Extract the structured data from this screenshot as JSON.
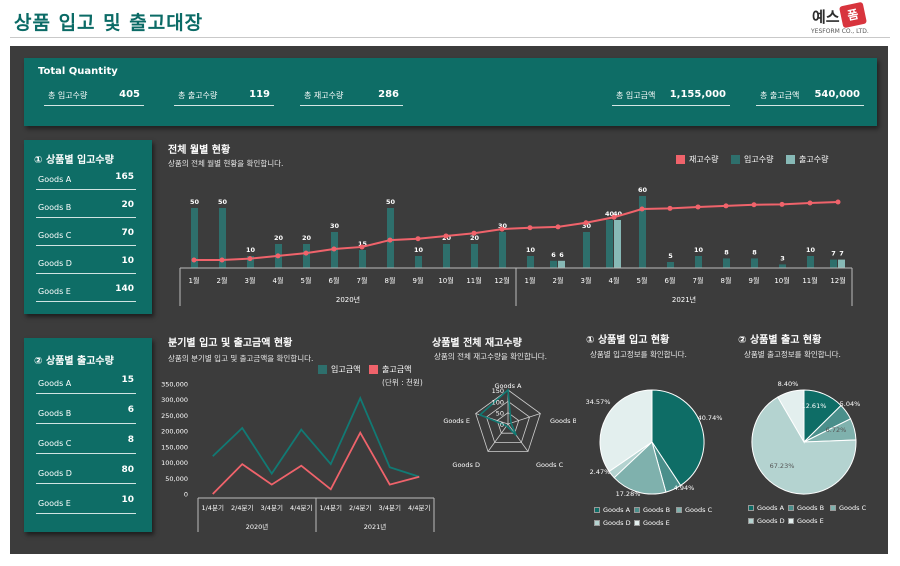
{
  "header": {
    "title": "상품 입고 및 출고대장",
    "logo_text": "예스",
    "logo_badge": "폼",
    "logo_sub": "YESFORM CO., LTD."
  },
  "totals": {
    "title": "Total Quantity",
    "items": [
      {
        "label": "총 입고수량",
        "value": "405"
      },
      {
        "label": "총 출고수량",
        "value": "119"
      },
      {
        "label": "총 재고수량",
        "value": "286"
      },
      {
        "label": "총 입고금액",
        "value": "1,155,000"
      },
      {
        "label": "총 출고금액",
        "value": "540,000"
      }
    ]
  },
  "in_panel": {
    "title": "① 상품별 입고수량",
    "rows": [
      {
        "label": "Goods A",
        "value": "165"
      },
      {
        "label": "Goods B",
        "value": "20"
      },
      {
        "label": "Goods C",
        "value": "70"
      },
      {
        "label": "Goods D",
        "value": "10"
      },
      {
        "label": "Goods E",
        "value": "140"
      }
    ]
  },
  "out_panel": {
    "title": "② 상품별 출고수량",
    "rows": [
      {
        "label": "Goods A",
        "value": "15"
      },
      {
        "label": "Goods B",
        "value": "6"
      },
      {
        "label": "Goods C",
        "value": "8"
      },
      {
        "label": "Goods D",
        "value": "80"
      },
      {
        "label": "Goods E",
        "value": "10"
      }
    ]
  },
  "monthly": {
    "title": "전체 월별 현황",
    "subtitle": "상품의 전체 월별 현황을 확인합니다.",
    "legend": [
      "재고수량",
      "입고수량",
      "출고수량"
    ],
    "colors": {
      "stock": "#f0636b",
      "in": "#2e6f6c",
      "out": "#87b9b6"
    }
  },
  "quarterly": {
    "title": "분기별 입고 및 출고금액 현황",
    "subtitle": "상품의 분기별 입고 및 출고금액을 확인합니다.",
    "legend": [
      "입고금액",
      "출고금액"
    ],
    "unit": "(단위 : 천원)"
  },
  "radar": {
    "title": "상품별 전체 재고수량",
    "subtitle": "상품의 전체 재고수량을 확인합니다."
  },
  "pie_in": {
    "title": "① 상품별 입고 현황",
    "subtitle": "상품별 입고정보를 확인합니다."
  },
  "pie_out": {
    "title": "② 상품별 출고 현황",
    "subtitle": "상품별 출고정보를 확인합니다."
  },
  "chart_data": [
    {
      "type": "bar",
      "title": "전체 월별 현황",
      "categories": [
        "1월",
        "2월",
        "3월",
        "4월",
        "5월",
        "6월",
        "7월",
        "8월",
        "9월",
        "10월",
        "11월",
        "12월",
        "1월",
        "2월",
        "3월",
        "4월",
        "5월",
        "6월",
        "7월",
        "8월",
        "9월",
        "10월",
        "11월",
        "12월"
      ],
      "groups": [
        {
          "label": "2020년",
          "from": 0,
          "to": 11
        },
        {
          "label": "2021년",
          "from": 12,
          "to": 23
        }
      ],
      "series": [
        {
          "name": "입고수량",
          "values": [
            50,
            50,
            10,
            20,
            20,
            30,
            15,
            50,
            10,
            20,
            20,
            30,
            10,
            6,
            30,
            40,
            60,
            5,
            10,
            8,
            8,
            3,
            10,
            7
          ]
        },
        {
          "name": "출고수량",
          "values": [
            0,
            0,
            0,
            0,
            0,
            0,
            0,
            0,
            0,
            0,
            0,
            0,
            0,
            6,
            0,
            40,
            0,
            0,
            0,
            0,
            0,
            0,
            0,
            7
          ]
        },
        {
          "name": "재고수량",
          "values": [
            50,
            50,
            60,
            80,
            100,
            130,
            145,
            195,
            205,
            225,
            245,
            275,
            285,
            291,
            321,
            361,
            421,
            426,
            436,
            444,
            452,
            455,
            465,
            472
          ]
        }
      ],
      "ylim": [
        0,
        60
      ]
    },
    {
      "type": "line",
      "title": "분기별 입고 및 출고금액 현황",
      "categories": [
        "1/4분기",
        "2/4분기",
        "3/4분기",
        "4/4분기",
        "1/4분기",
        "2/4분기",
        "3/4분기",
        "4/4분기"
      ],
      "groups": [
        {
          "label": "2020년",
          "from": 0,
          "to": 3
        },
        {
          "label": "2021년",
          "from": 4,
          "to": 7
        }
      ],
      "series": [
        {
          "name": "입고금액",
          "values": [
            120000,
            210000,
            65000,
            205000,
            95000,
            305000,
            85000,
            55000
          ]
        },
        {
          "name": "출고금액",
          "values": [
            0,
            95000,
            30000,
            90000,
            15000,
            195000,
            30000,
            55000
          ]
        }
      ],
      "ylim": [
        0,
        350000
      ],
      "yticks": [
        "350,000",
        "300,000",
        "250,000",
        "200,000",
        "150,000",
        "100,000",
        "50,000",
        "0"
      ]
    },
    {
      "type": "radar",
      "title": "상품별 전체 재고수량",
      "categories": [
        "Goods A",
        "Goods B",
        "Goods C",
        "Goods D",
        "Goods E"
      ],
      "values": [
        150,
        14,
        62,
        10,
        130
      ],
      "ticks": [
        "150",
        "100",
        "50",
        "0"
      ],
      "rmax": 150
    },
    {
      "type": "pie",
      "title": "① 상품별 입고 현황",
      "categories": [
        "Goods A",
        "Goods B",
        "Goods C",
        "Goods D",
        "Goods E"
      ],
      "values": [
        40.74,
        4.94,
        17.28,
        2.47,
        34.57
      ],
      "labels": [
        "40.74%",
        "4.94%",
        "17.28%",
        "2.47%",
        "34.57%"
      ]
    },
    {
      "type": "pie",
      "title": "② 상품별 출고 현황",
      "categories": [
        "Goods A",
        "Goods B",
        "Goods C",
        "Goods D",
        "Goods E"
      ],
      "values": [
        12.61,
        5.04,
        6.72,
        67.23,
        8.4
      ],
      "labels": [
        "12.61%",
        "5.04%",
        "6.72%",
        "67.23%",
        "8.40%"
      ]
    }
  ]
}
